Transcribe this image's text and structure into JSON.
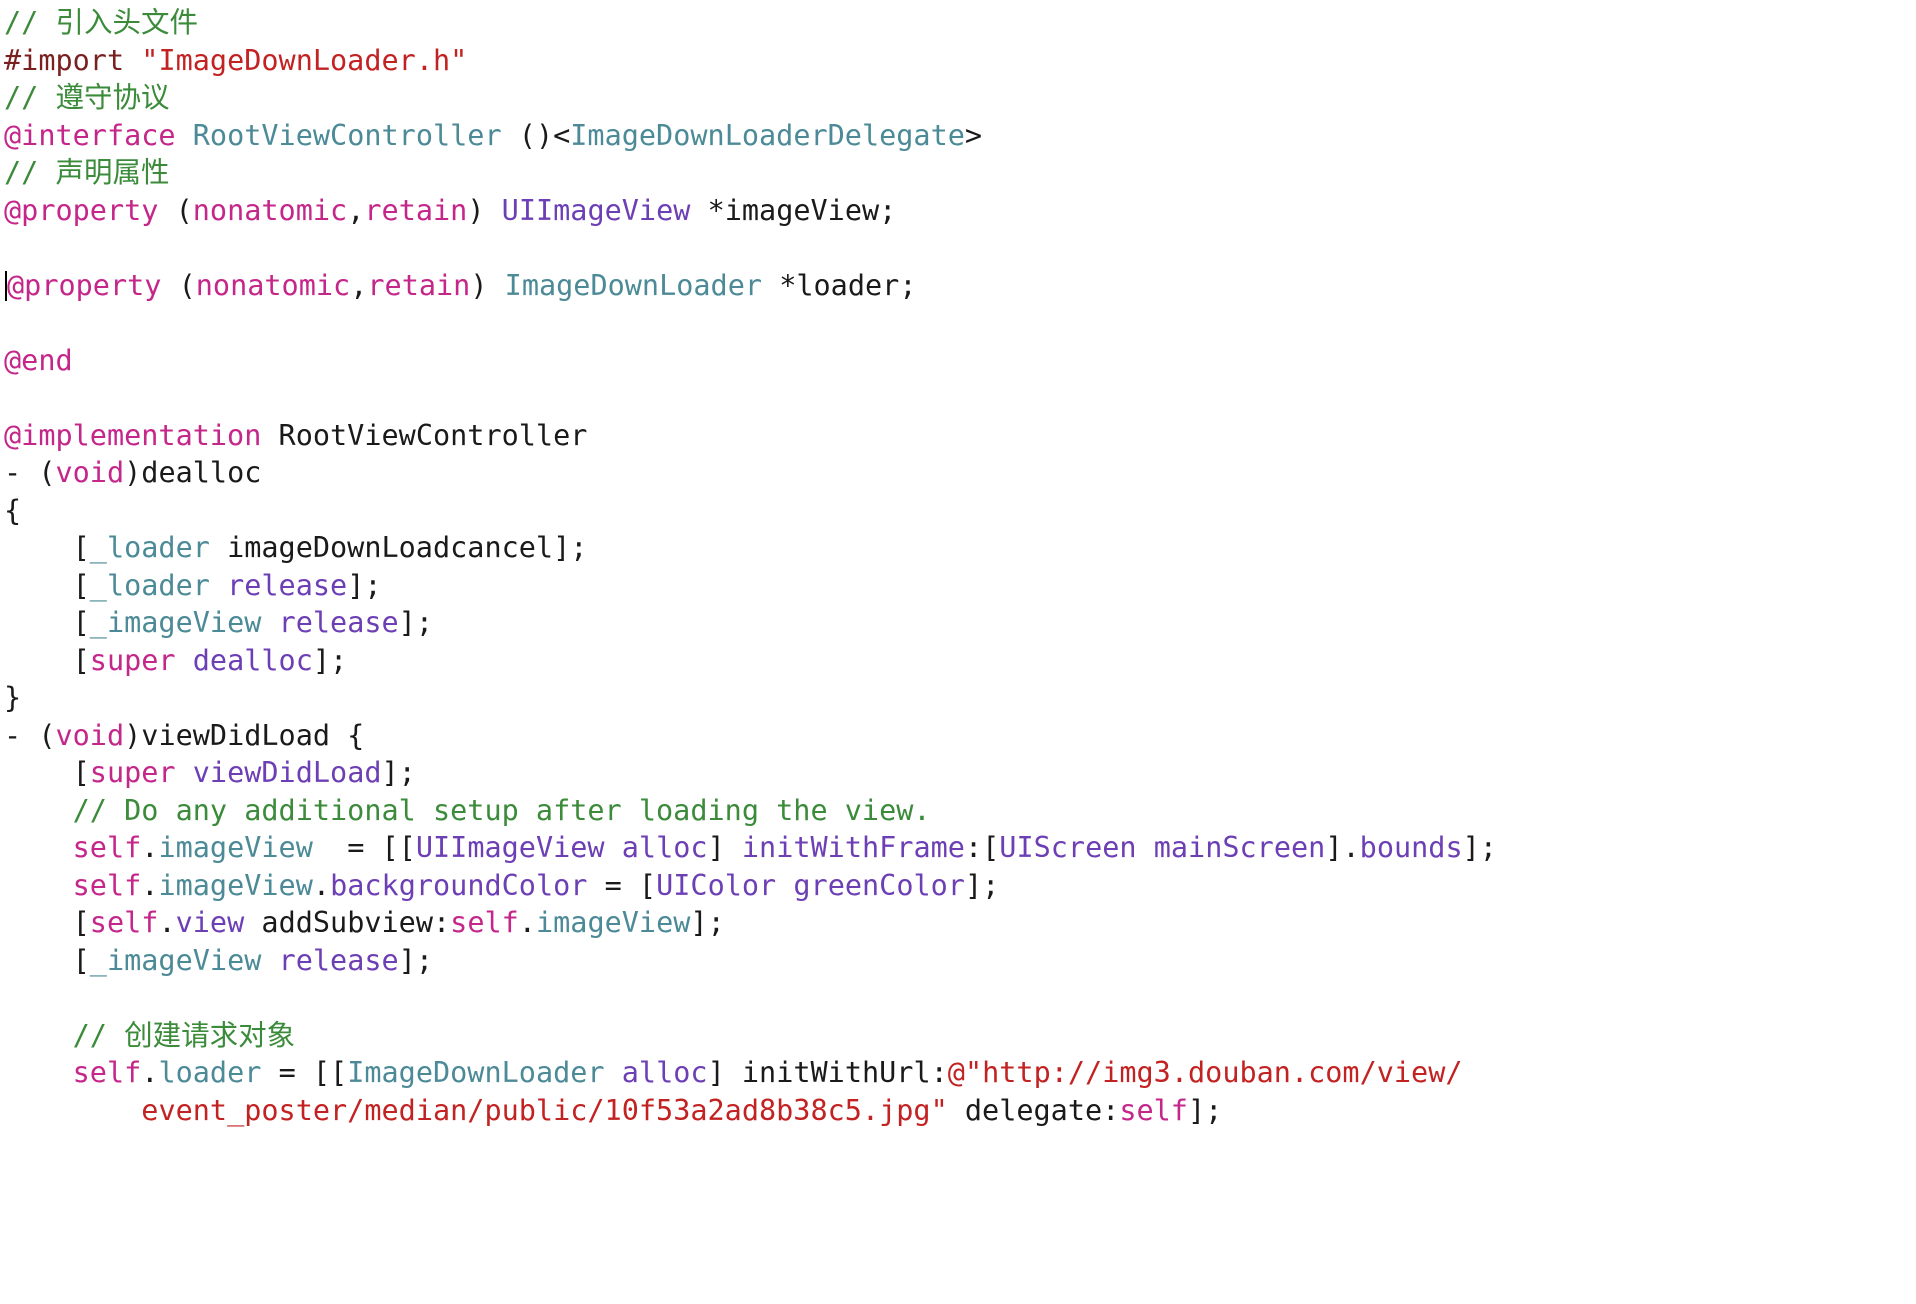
{
  "editor": {
    "language": "Objective-C",
    "background_color": "#ffffff",
    "caret_line_index": 7,
    "colors": {
      "comment": "#3b8b3b",
      "keyword": "#c4268a",
      "preprocessor": "#7a2020",
      "string": "#c32222",
      "user_type": "#4b8a96",
      "system_type": "#6d3fb5",
      "plain": "#1a1a1a"
    }
  },
  "code_lines": [
    [
      {
        "t": "// 引入头文件",
        "c": "cmt"
      }
    ],
    [
      {
        "t": "#import ",
        "c": "pre"
      },
      {
        "t": "\"ImageDownLoader.h\"",
        "c": "str"
      }
    ],
    [
      {
        "t": "// 遵守协议",
        "c": "cmt"
      }
    ],
    [
      {
        "t": "@interface",
        "c": "kw"
      },
      {
        "t": " ",
        "c": "pln"
      },
      {
        "t": "RootViewController",
        "c": "usr"
      },
      {
        "t": " ()<",
        "c": "pln"
      },
      {
        "t": "ImageDownLoaderDelegate",
        "c": "usr"
      },
      {
        "t": ">",
        "c": "pln"
      }
    ],
    [
      {
        "t": "// 声明属性",
        "c": "cmt"
      }
    ],
    [
      {
        "t": "@property",
        "c": "kw"
      },
      {
        "t": " (",
        "c": "pln"
      },
      {
        "t": "nonatomic",
        "c": "kw"
      },
      {
        "t": ",",
        "c": "pln"
      },
      {
        "t": "retain",
        "c": "kw"
      },
      {
        "t": ") ",
        "c": "pln"
      },
      {
        "t": "UIImageView",
        "c": "sys"
      },
      {
        "t": " *imageView;",
        "c": "pln"
      }
    ],
    [],
    [
      {
        "t": "@property",
        "c": "kw"
      },
      {
        "t": " (",
        "c": "pln"
      },
      {
        "t": "nonatomic",
        "c": "kw"
      },
      {
        "t": ",",
        "c": "pln"
      },
      {
        "t": "retain",
        "c": "kw"
      },
      {
        "t": ") ",
        "c": "pln"
      },
      {
        "t": "ImageDownLoader",
        "c": "usr"
      },
      {
        "t": " *loader;",
        "c": "pln"
      }
    ],
    [],
    [
      {
        "t": "@end",
        "c": "kw"
      }
    ],
    [],
    [
      {
        "t": "@implementation",
        "c": "kw"
      },
      {
        "t": " RootViewController",
        "c": "pln"
      }
    ],
    [
      {
        "t": "- (",
        "c": "pln"
      },
      {
        "t": "void",
        "c": "kw"
      },
      {
        "t": ")dealloc",
        "c": "pln"
      }
    ],
    [
      {
        "t": "{",
        "c": "pln"
      }
    ],
    [
      {
        "t": "    [",
        "c": "pln"
      },
      {
        "t": "_loader",
        "c": "usr"
      },
      {
        "t": " imageDownLoadcancel];",
        "c": "pln"
      }
    ],
    [
      {
        "t": "    [",
        "c": "pln"
      },
      {
        "t": "_loader",
        "c": "usr"
      },
      {
        "t": " ",
        "c": "pln"
      },
      {
        "t": "release",
        "c": "sys"
      },
      {
        "t": "];",
        "c": "pln"
      }
    ],
    [
      {
        "t": "    [",
        "c": "pln"
      },
      {
        "t": "_imageView",
        "c": "usr"
      },
      {
        "t": " ",
        "c": "pln"
      },
      {
        "t": "release",
        "c": "sys"
      },
      {
        "t": "];",
        "c": "pln"
      }
    ],
    [
      {
        "t": "    [",
        "c": "pln"
      },
      {
        "t": "super",
        "c": "kw"
      },
      {
        "t": " ",
        "c": "pln"
      },
      {
        "t": "dealloc",
        "c": "sys"
      },
      {
        "t": "];",
        "c": "pln"
      }
    ],
    [
      {
        "t": "}",
        "c": "pln"
      }
    ],
    [
      {
        "t": "- (",
        "c": "pln"
      },
      {
        "t": "void",
        "c": "kw"
      },
      {
        "t": ")viewDidLoad {",
        "c": "pln"
      }
    ],
    [
      {
        "t": "    [",
        "c": "pln"
      },
      {
        "t": "super",
        "c": "kw"
      },
      {
        "t": " ",
        "c": "pln"
      },
      {
        "t": "viewDidLoad",
        "c": "sys"
      },
      {
        "t": "];",
        "c": "pln"
      }
    ],
    [
      {
        "t": "    ",
        "c": "pln"
      },
      {
        "t": "// Do any additional setup after loading the view.",
        "c": "cmt"
      }
    ],
    [
      {
        "t": "    ",
        "c": "pln"
      },
      {
        "t": "self",
        "c": "kw"
      },
      {
        "t": ".",
        "c": "pln"
      },
      {
        "t": "imageView",
        "c": "usr"
      },
      {
        "t": "  = [[",
        "c": "pln"
      },
      {
        "t": "UIImageView",
        "c": "sys"
      },
      {
        "t": " ",
        "c": "pln"
      },
      {
        "t": "alloc",
        "c": "sys"
      },
      {
        "t": "] ",
        "c": "pln"
      },
      {
        "t": "initWithFrame",
        "c": "sys"
      },
      {
        "t": ":[",
        "c": "pln"
      },
      {
        "t": "UIScreen",
        "c": "sys"
      },
      {
        "t": " ",
        "c": "pln"
      },
      {
        "t": "mainScreen",
        "c": "sys"
      },
      {
        "t": "].",
        "c": "pln"
      },
      {
        "t": "bounds",
        "c": "sys"
      },
      {
        "t": "];",
        "c": "pln"
      }
    ],
    [
      {
        "t": "    ",
        "c": "pln"
      },
      {
        "t": "self",
        "c": "kw"
      },
      {
        "t": ".",
        "c": "pln"
      },
      {
        "t": "imageView",
        "c": "usr"
      },
      {
        "t": ".",
        "c": "pln"
      },
      {
        "t": "backgroundColor",
        "c": "sys"
      },
      {
        "t": " = [",
        "c": "pln"
      },
      {
        "t": "UIColor",
        "c": "sys"
      },
      {
        "t": " ",
        "c": "pln"
      },
      {
        "t": "greenColor",
        "c": "sys"
      },
      {
        "t": "];",
        "c": "pln"
      }
    ],
    [
      {
        "t": "    [",
        "c": "pln"
      },
      {
        "t": "self",
        "c": "kw"
      },
      {
        "t": ".",
        "c": "pln"
      },
      {
        "t": "view",
        "c": "sys"
      },
      {
        "t": " addSubview:",
        "c": "pln"
      },
      {
        "t": "self",
        "c": "kw"
      },
      {
        "t": ".",
        "c": "pln"
      },
      {
        "t": "imageView",
        "c": "usr"
      },
      {
        "t": "];",
        "c": "pln"
      }
    ],
    [
      {
        "t": "    [",
        "c": "pln"
      },
      {
        "t": "_imageView",
        "c": "usr"
      },
      {
        "t": " ",
        "c": "pln"
      },
      {
        "t": "release",
        "c": "sys"
      },
      {
        "t": "];",
        "c": "pln"
      }
    ],
    [],
    [
      {
        "t": "    ",
        "c": "pln"
      },
      {
        "t": "// 创建请求对象",
        "c": "cmt"
      }
    ],
    [
      {
        "t": "    ",
        "c": "pln"
      },
      {
        "t": "self",
        "c": "kw"
      },
      {
        "t": ".",
        "c": "pln"
      },
      {
        "t": "loader",
        "c": "usr"
      },
      {
        "t": " = [[",
        "c": "pln"
      },
      {
        "t": "ImageDownLoader",
        "c": "usr"
      },
      {
        "t": " ",
        "c": "pln"
      },
      {
        "t": "alloc",
        "c": "sys"
      },
      {
        "t": "] initWithUrl:",
        "c": "pln"
      },
      {
        "t": "@\"http://img3.douban.com/view/",
        "c": "str"
      }
    ],
    [
      {
        "t": "        ",
        "c": "pln"
      },
      {
        "t": "event_poster/median/public/10f53a2ad8b38c5.jpg\"",
        "c": "str"
      },
      {
        "t": " delegate:",
        "c": "pln"
      },
      {
        "t": "self",
        "c": "kw"
      },
      {
        "t": "];",
        "c": "pln"
      }
    ]
  ]
}
